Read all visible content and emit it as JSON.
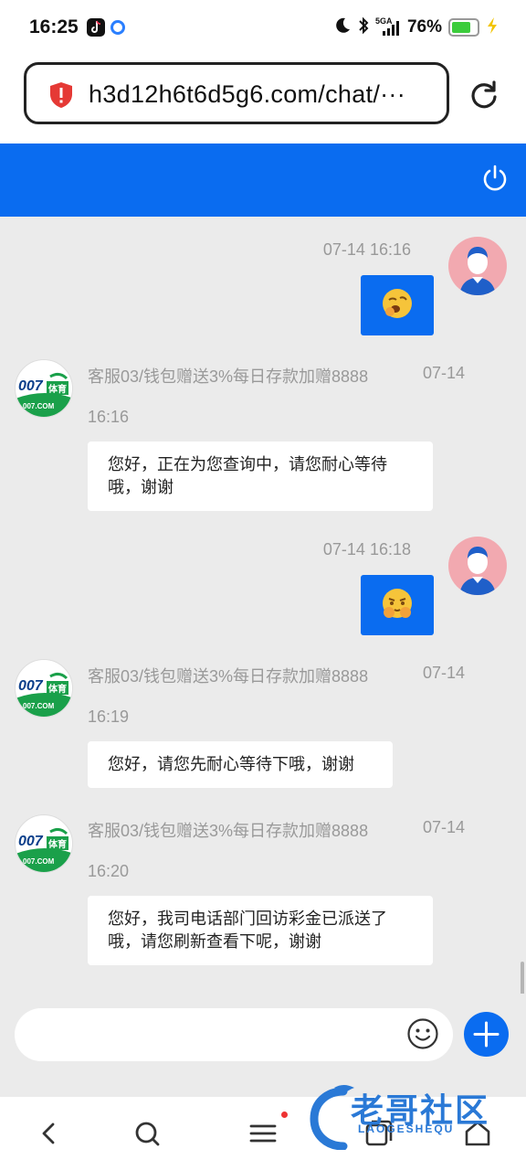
{
  "status_bar": {
    "time": "16:25",
    "network": "5GA",
    "battery": "76%",
    "battery_level": 0.76,
    "icons": [
      "tiktok-icon",
      "app-icon",
      "moon-icon",
      "bluetooth-icon",
      "signal-icon",
      "battery-icon",
      "charging-icon"
    ]
  },
  "browser": {
    "url": "h3d12h6t6d5g6.com/chat/···",
    "icons": [
      "warning-shield-icon",
      "reload-icon"
    ]
  },
  "header": {
    "icon": "power-icon",
    "color": "#0a6cf0"
  },
  "messages": [
    {
      "sender": "user",
      "timestamp": "07-14 16:16",
      "emoji": "yawning-face-emoji"
    },
    {
      "sender": "agent",
      "name": "客服03/钱包赠送3%每日存款加赠8888",
      "date": "07-14",
      "time": "16:16",
      "text": "您好，正在为您查询中，请您耐心等待哦，谢谢"
    },
    {
      "sender": "user",
      "timestamp": "07-14 16:18",
      "emoji": "pleading-face-emoji"
    },
    {
      "sender": "agent",
      "name": "客服03/钱包赠送3%每日存款加赠8888",
      "date": "07-14",
      "time": "16:19",
      "text": "您好，请您先耐心等待下哦，谢谢"
    },
    {
      "sender": "agent",
      "name": "客服03/钱包赠送3%每日存款加赠8888",
      "date": "07-14",
      "time": "16:20",
      "text": "您好，我司电话部门回访彩金已派送了哦，请您刷新查看下呢，谢谢"
    }
  ],
  "agent_avatar": {
    "logo_text": "007",
    "logo_suffix": "体育",
    "logo_domain": "007.COM"
  },
  "input": {
    "placeholder": "",
    "icons": [
      "smiley-icon",
      "plus-icon"
    ]
  },
  "bottom_nav": {
    "icons": [
      "back-icon",
      "search-icon",
      "menu-icon",
      "tabs-icon",
      "home-icon"
    ]
  },
  "watermark": {
    "text": "老哥社区",
    "sub": "LAOGESHEQU"
  }
}
